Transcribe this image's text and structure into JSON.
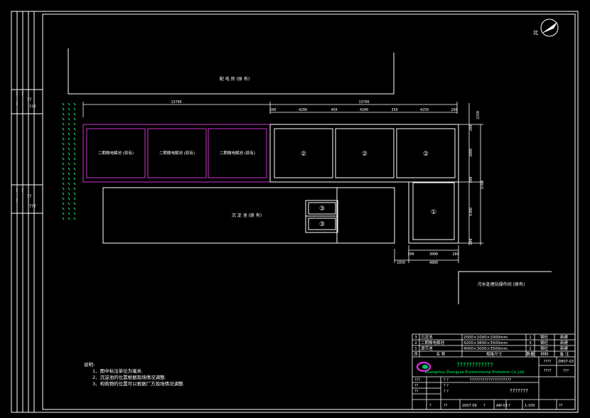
{
  "north_label": "北",
  "buildings": {
    "power_room": "配 电 房 (原 有)",
    "tank_phase2_a": "二期微电解池 (原有)",
    "tank_phase2_b": "二期微电解池 (原有)",
    "tank_phase2_c": "二期微电解池 (原有)",
    "sedimentation_tank": "沉 淀 池 (原 有)",
    "sewage_workshop": "污水处理站操作间 (原有)"
  },
  "tank_markers": [
    "②",
    "②",
    "②",
    "①",
    "③",
    "③"
  ],
  "dimensions": {
    "top_left": "13700",
    "top_right": "13700",
    "d1": "200",
    "d2": "4200",
    "d3": "450",
    "d4": "4200",
    "d5": "350",
    "d6": "4250",
    "d7": "200",
    "right_top": "2250",
    "right_1": "200",
    "right_2": "3800",
    "right_3": "200",
    "right_4": "4300",
    "right_5": "200",
    "right_total": "8700",
    "bot_1": "200",
    "bot_2": "3000",
    "bot_3": "200",
    "bot_left": "1050",
    "bot_total": "4800"
  },
  "notes": {
    "title": "说明:",
    "items": [
      "1、图中标注单位为毫米.",
      "2、沉淀池的位置根据现场情况调整.",
      "3、构筑物的位置可以根据厂方现场情况调整."
    ]
  },
  "title_block": {
    "rows": [
      {
        "no": "3",
        "name": "沉淀池",
        "spec": "2000×1000×1000mm",
        "qty": "1",
        "material": "钢砼",
        "note": "新建"
      },
      {
        "no": "2",
        "name": "二期微电解池",
        "spec": "4200×3800×3500mm",
        "qty": "3",
        "material": "钢砼",
        "note": "新建"
      },
      {
        "no": "1",
        "name": "调节池",
        "spec": "4000×3000×3500mm",
        "qty": "1",
        "material": "钢砼",
        "note": "新建"
      }
    ],
    "header": {
      "no": "序",
      "name": "名 称",
      "spec": "规格尺寸",
      "qty": "数量",
      "material": "材料",
      "note": "备 注"
    },
    "company_cn": "????????????",
    "company_en": "Guangzhou Zhongyue Environmental Protection Co.,Ltd.",
    "project": "????????????????????",
    "drawing_title": "???????",
    "cells": {
      "r1c1": "???",
      "r1c2": "? ?",
      "r2c1": "??",
      "r2c2": "? ?",
      "r3c1": "??",
      "r3c2": "? ?",
      "right_a": "????",
      "right_b": "ZM07-03",
      "right_c": "????",
      "right_d": "???",
      "bottom_date": "2007.09",
      "bottom_no": "AM-03",
      "bottom_scale": "1:100",
      "bottom_sheet": "?",
      "bottom_total": "??",
      "bottom_q1": "?",
      "bottom_q2": "??",
      "bottom_q3": "?"
    }
  },
  "left_strip": {
    "group1": [
      "?",
      "?",
      "?",
      "??",
      "???"
    ],
    "group2": [
      "?",
      "?",
      "?",
      "??",
      "???"
    ]
  }
}
